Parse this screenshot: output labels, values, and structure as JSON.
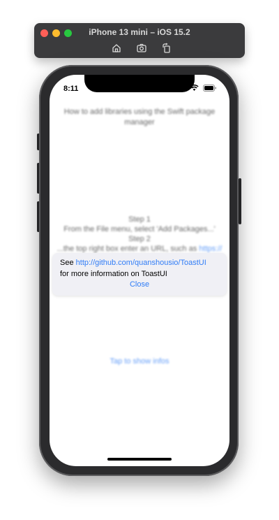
{
  "simulator": {
    "title": "iPhone 13 mini – iOS 15.2",
    "icons": [
      "home-icon",
      "screenshot-icon",
      "rotate-icon"
    ]
  },
  "status_bar": {
    "time": "8:11"
  },
  "background": {
    "title": "How to add libraries using the Swift package manager",
    "step1_label": "Step 1",
    "step1_text": "From the File menu, select 'Add Packages...'",
    "step2_label": "Step 2",
    "step2_text": "...the top right box enter an URL, such as",
    "step2_link": "https://",
    "tap_link": "Tap to show infos"
  },
  "toast": {
    "prefix": "See ",
    "link": "http://github.com/quanshousio/ToastUI",
    "line2": "for more information on ToastUI",
    "close_label": "Close"
  },
  "colors": {
    "link": "#2f7cf6",
    "toast_bg": "#f0f0f5",
    "sim_bar": "#3b3b3d"
  }
}
